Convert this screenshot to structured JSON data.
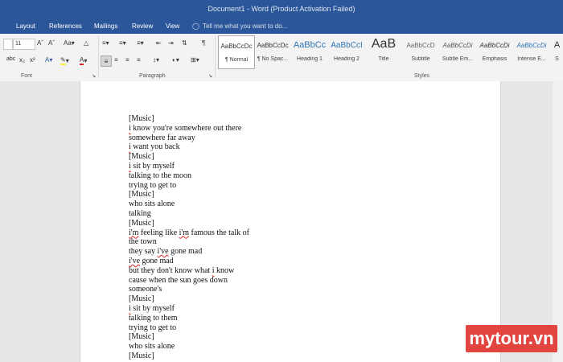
{
  "window": {
    "title": "Document1 - Word (Product Activation Failed)"
  },
  "tabs": [
    "Layout",
    "References",
    "Mailings",
    "Review",
    "View"
  ],
  "search": {
    "placeholder": "Tell me what you want to do..."
  },
  "font": {
    "size_value": "11",
    "group_label": "Font"
  },
  "paragraph": {
    "group_label": "Paragraph"
  },
  "styles": {
    "group_label": "Styles",
    "items": [
      {
        "sample": "AaBbCcDc",
        "name": "¶ Normal"
      },
      {
        "sample": "AaBbCcDc",
        "name": "¶ No Spac..."
      },
      {
        "sample": "AaBbCc",
        "name": "Heading 1"
      },
      {
        "sample": "AaBbCcI",
        "name": "Heading 2"
      },
      {
        "sample": "AaB",
        "name": "Title"
      },
      {
        "sample": "AaBbCcD",
        "name": "Subtitle"
      },
      {
        "sample": "AaBbCcDi",
        "name": "Subtle Em..."
      },
      {
        "sample": "AaBbCcDi",
        "name": "Emphasis"
      },
      {
        "sample": "AaBbCcDi",
        "name": "Intense E..."
      },
      {
        "sample": "A",
        "name": "S"
      }
    ]
  },
  "document": {
    "lines": [
      "[Music]",
      "i know you're somewhere out there",
      "somewhere far away",
      "i want you back",
      "[Music]",
      "i sit by myself",
      "talking to the moon",
      "trying to get to",
      "[Music]",
      "who sits alone",
      "talking",
      "[Music]",
      "i'm feeling like i'm famous the talk of",
      "the town",
      "they say i've gone mad",
      "i've gone mad",
      "but they don't know what i know",
      "cause when the sun goes down",
      "someone's",
      "[Music]",
      "i sit by myself",
      "talking to them",
      "trying to get to",
      "[Music]",
      "who sits alone",
      "[Music]"
    ]
  },
  "watermark": {
    "text": "mytour.vn"
  }
}
